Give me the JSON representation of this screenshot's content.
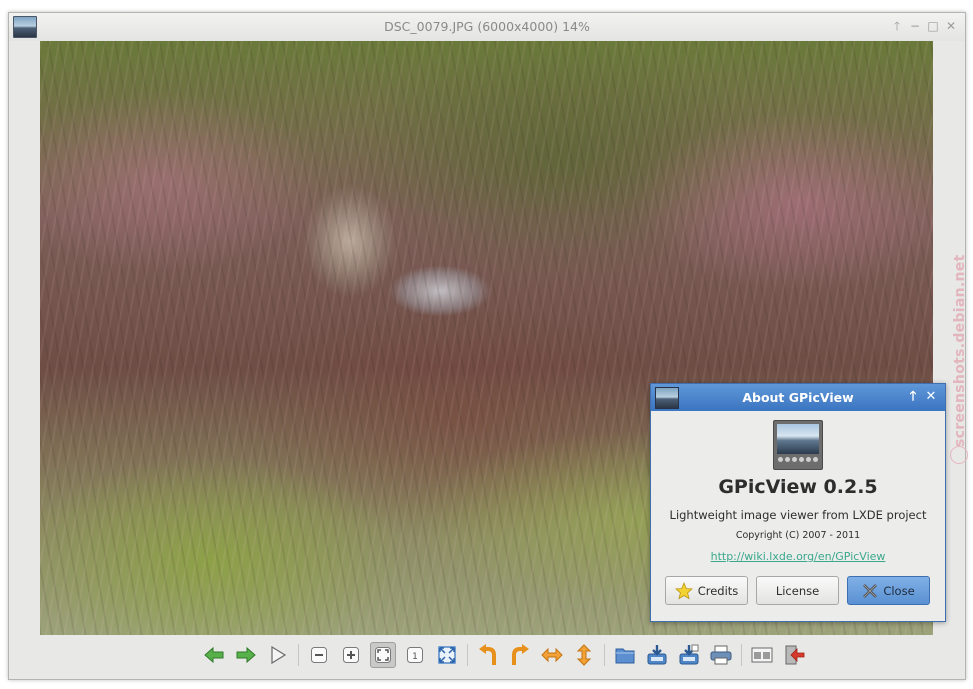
{
  "window": {
    "title": "DSC_0079.JPG (6000x4000) 14%"
  },
  "toolbar": {
    "buttons": [
      {
        "name": "previous-button",
        "icon": "arrow-left-green-icon"
      },
      {
        "name": "next-button",
        "icon": "arrow-right-green-icon"
      },
      {
        "name": "slideshow-button",
        "icon": "play-icon"
      },
      {
        "name": "zoom-out-button",
        "icon": "zoom-out-icon"
      },
      {
        "name": "zoom-in-button",
        "icon": "zoom-in-icon"
      },
      {
        "name": "zoom-fit-button",
        "icon": "zoom-fit-icon",
        "active": true
      },
      {
        "name": "zoom-original-button",
        "icon": "zoom-original-icon"
      },
      {
        "name": "fullscreen-button",
        "icon": "fullscreen-icon"
      },
      {
        "name": "rotate-left-button",
        "icon": "rotate-left-icon"
      },
      {
        "name": "rotate-right-button",
        "icon": "rotate-right-icon"
      },
      {
        "name": "flip-horizontal-button",
        "icon": "flip-horizontal-icon"
      },
      {
        "name": "flip-vertical-button",
        "icon": "flip-vertical-icon"
      },
      {
        "name": "open-file-button",
        "icon": "folder-icon"
      },
      {
        "name": "save-button",
        "icon": "save-icon"
      },
      {
        "name": "save-as-button",
        "icon": "save-as-icon"
      },
      {
        "name": "print-button",
        "icon": "printer-icon"
      },
      {
        "name": "preferences-button",
        "icon": "preferences-icon"
      },
      {
        "name": "quit-button",
        "icon": "exit-icon"
      }
    ]
  },
  "watermark": {
    "text": "screenshots.debian.net"
  },
  "about_dialog": {
    "title": "About GPicView",
    "app_name": "GPicView 0.2.5",
    "description": "Lightweight image viewer from LXDE project",
    "copyright": "Copyright (C) 2007 - 2011",
    "website": "http://wiki.lxde.org/en/GPicView",
    "credits_label": "Credits",
    "license_label": "License",
    "close_label": "Close"
  },
  "colors": {
    "dialog_titlebar": "#3b75c0",
    "link": "#3aa88c",
    "primary_button": "#5a91d3"
  }
}
